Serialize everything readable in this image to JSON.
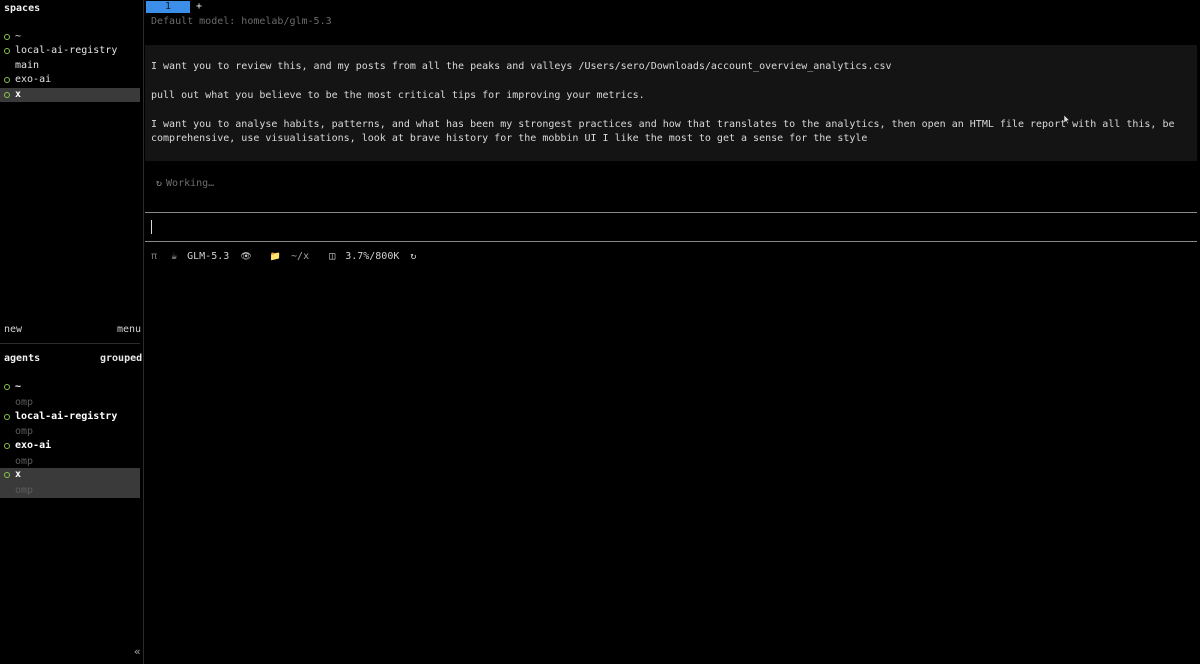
{
  "sidebar": {
    "spaces_title": "spaces",
    "spaces": [
      {
        "label": "~",
        "dot": true,
        "selected": false
      },
      {
        "label": "local-ai-registry",
        "dot": true,
        "selected": false
      },
      {
        "label": "main",
        "dot": false,
        "selected": false
      },
      {
        "label": "exo-ai",
        "dot": true,
        "selected": false
      },
      {
        "label": "x",
        "dot": true,
        "selected": true
      }
    ],
    "new_label": "new",
    "menu_label": "menu",
    "agents_title": "agents",
    "grouped_label": "grouped",
    "agents": [
      {
        "label": "~",
        "sub": "omp",
        "selected": false
      },
      {
        "label": "local-ai-registry",
        "sub": "omp",
        "selected": false
      },
      {
        "label": "exo-ai",
        "sub": "omp",
        "selected": false
      },
      {
        "label": "x",
        "sub": "omp",
        "selected": true
      }
    ],
    "collapse_glyph": "«"
  },
  "main": {
    "tab_label": "1",
    "tab_add": "+",
    "default_model": "Default model: homelab/glm-5.3",
    "message_lines": [
      "I want you to review this, and my posts from all the peaks and valleys /Users/sero/Downloads/account_overview_analytics.csv",
      "pull out what you believe to be the most critical tips for improving your metrics.",
      "I want you to analyse habits, patterns, and what has been my strongest practices and how that translates to the analytics, then open an HTML file report with all this, be",
      "comprehensive, use visualisations, look at brave history for the mobbin UI I like the most to get a sense for the style"
    ],
    "working_icon": "↻",
    "working_text": "Working…",
    "status": {
      "pi": "π",
      "model_icon": "☕",
      "model": "GLM-5.3",
      "eye_icon": "👁",
      "folder_icon": "📁",
      "path": "~/x",
      "context_icon": "◫",
      "context": "3.7%/800K",
      "refresh_icon": "↻"
    }
  },
  "colors": {
    "accent_tab": "#3b8fe8",
    "status_dot": "#8bc34a",
    "selected_row": "#3a3a3a",
    "message_bg": "#141414"
  }
}
